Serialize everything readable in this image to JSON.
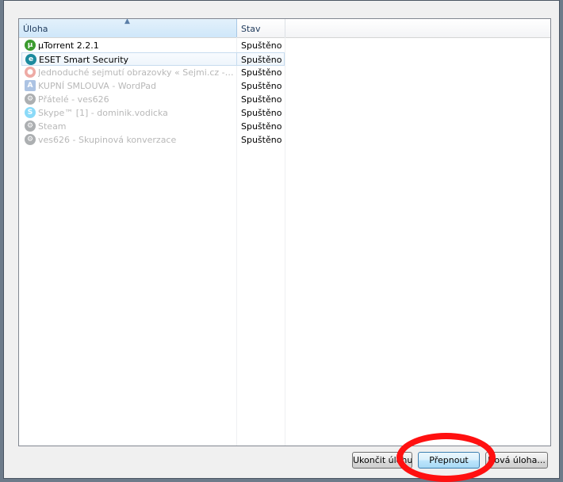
{
  "table": {
    "columns": {
      "task": "Úloha",
      "status": "Stav"
    },
    "rows": [
      {
        "name": "µTorrent 2.2.1",
        "status": "Spuštěno",
        "icon": "utorrent-icon",
        "color": "#3b9b2f"
      },
      {
        "name": "ESET Smart Security",
        "status": "Spuštěno",
        "icon": "eset-icon",
        "color": "#1c8a9e"
      },
      {
        "name": "Jednoduché sejmutí obrazovky « Sejmi.cz - Google Chrome",
        "status": "Spuštěno",
        "icon": "chrome-icon",
        "color": "#db4437"
      },
      {
        "name": "KUPNÍ SMLOUVA - WordPad",
        "status": "Spuštěno",
        "icon": "wordpad-icon",
        "color": "#4a7cc2"
      },
      {
        "name": "Přátelé - ves626",
        "status": "Spuštěno",
        "icon": "steam-icon",
        "color": "#4a4f55"
      },
      {
        "name": "Skype™ [1] - dominik.vodicka",
        "status": "Spuštěno",
        "icon": "skype-icon",
        "color": "#00aff0"
      },
      {
        "name": "Steam",
        "status": "Spuštěno",
        "icon": "steam-icon",
        "color": "#4a4f55"
      },
      {
        "name": "ves626 - Skupinová konverzace",
        "status": "Spuštěno",
        "icon": "steam-icon",
        "color": "#4a4f55"
      }
    ]
  },
  "buttons": {
    "end_task": "Ukončit úlohu",
    "switch_to": "Přepnout",
    "new_task": "Nová úloha..."
  }
}
